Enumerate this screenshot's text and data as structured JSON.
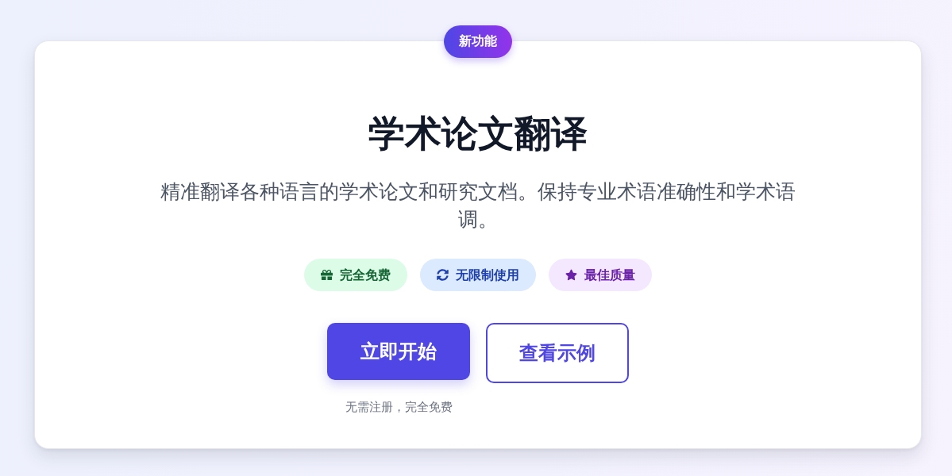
{
  "badge": {
    "label": "新功能"
  },
  "title": "学术论文翻译",
  "description": "精准翻译各种语言的学术论文和研究文档。保持专业术语准确性和学术语调。",
  "features": [
    {
      "kind": "gift",
      "label": "完全免费",
      "color": "#dcfce7"
    },
    {
      "kind": "refresh",
      "label": "无限制使用",
      "color": "#dbeafe"
    },
    {
      "kind": "star",
      "label": "最佳质量",
      "color": "#f3e8ff"
    }
  ],
  "actions": {
    "primary": {
      "label": "立即开始"
    },
    "secondary": {
      "label": "查看示例"
    },
    "note": "无需注册，完全免费"
  }
}
